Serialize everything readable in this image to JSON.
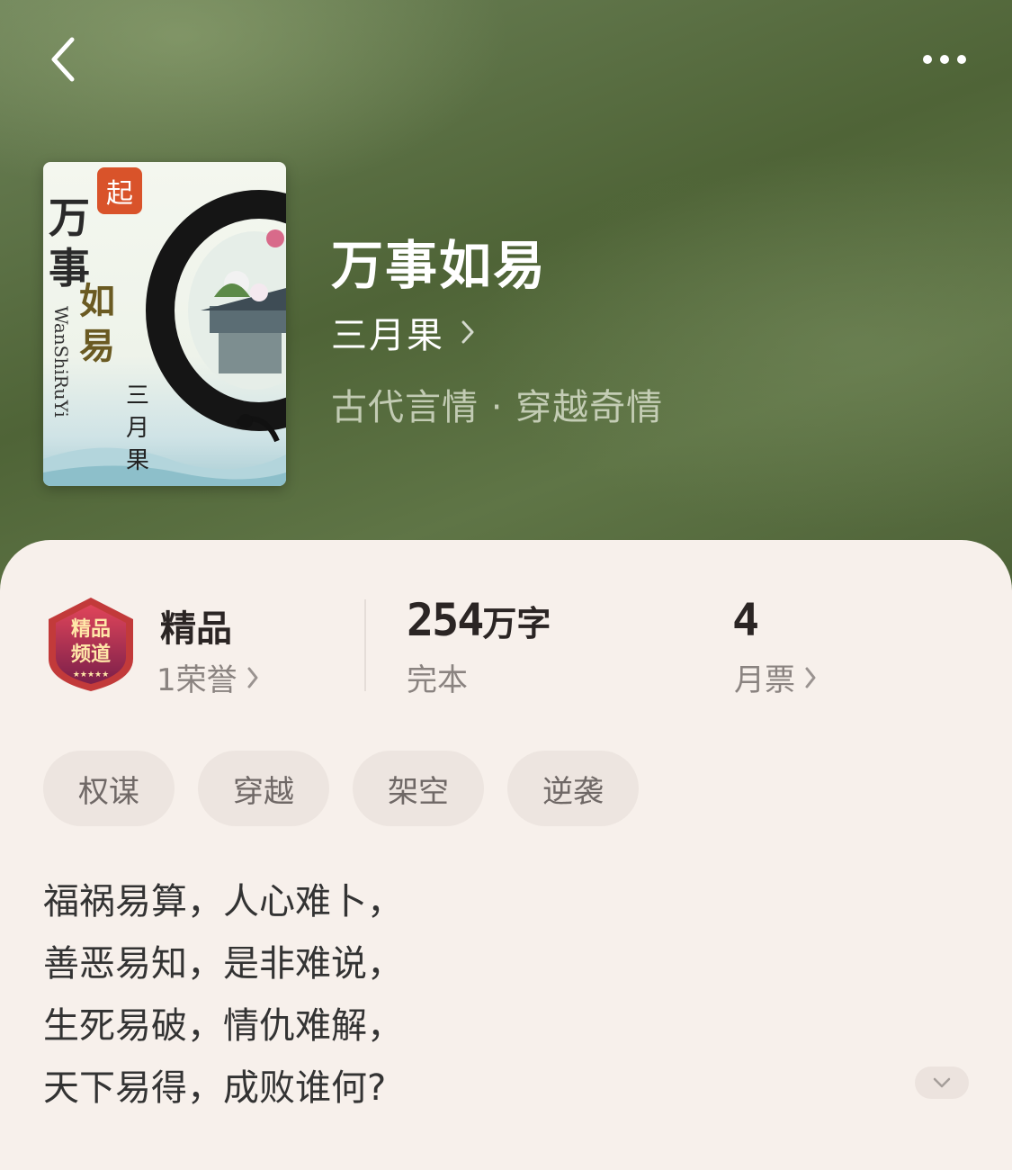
{
  "nav": {
    "back_icon": "chevron-left-icon",
    "more_icon": "more-horizontal-icon"
  },
  "book": {
    "title": "万事如易",
    "author": "三月果",
    "genre": "古代言情 · 穿越奇情",
    "cover": {
      "badge": "起",
      "title_chars": [
        "万",
        "事"
      ],
      "sub_chars": [
        "如",
        "易"
      ],
      "pinyin": "WanShiRuYi",
      "author_chars": [
        "三",
        "月",
        "果"
      ]
    }
  },
  "stats": {
    "honor": {
      "label": "精品",
      "sub": "1荣誉"
    },
    "words": {
      "number": "254",
      "unit": "万字",
      "status": "完本"
    },
    "tickets": {
      "number": "4",
      "label": "月票"
    }
  },
  "tags": [
    "权谋",
    "穿越",
    "架空",
    "逆袭"
  ],
  "intro": [
    "福祸易算，人心难卜，",
    "善恶易知，是非难说，",
    "生死易破，情仇难解，",
    "天下易得，成败谁何?"
  ],
  "colors": {
    "hero_bg": "#55693d",
    "sheet_bg": "#f7f0eb",
    "tag_bg": "#ede5e0",
    "text_primary": "#2b2524",
    "text_secondary": "#8a8380"
  }
}
